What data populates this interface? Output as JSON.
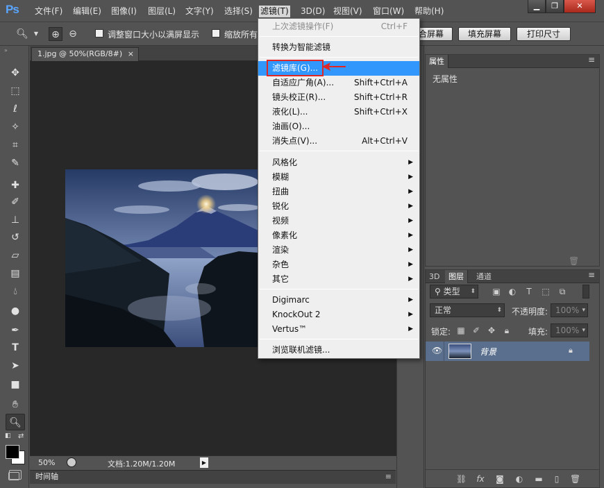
{
  "app": {
    "logo": "Ps"
  },
  "menubar": {
    "items": [
      "文件(F)",
      "编辑(E)",
      "图像(I)",
      "图层(L)",
      "文字(Y)",
      "选择(S)",
      "滤镜(T)",
      "3D(D)",
      "视图(V)",
      "窗口(W)",
      "帮助(H)"
    ],
    "active_index": 6,
    "window_buttons": [
      "minimize",
      "restore",
      "close"
    ]
  },
  "options_bar": {
    "resize_windows_label": "调整窗口大小以满屏显示",
    "zoom_all_label": "缩放所有",
    "fit_screen_label": "合屏幕",
    "fill_screen_label": "填充屏幕",
    "print_size_label": "打印尺寸"
  },
  "toolbox": {
    "tools": [
      "move-icon",
      "marquee-icon",
      "lasso-icon",
      "magic-wand-icon",
      "crop-icon",
      "eyedropper-icon",
      "healing-brush-icon",
      "brush-icon",
      "stamp-icon",
      "history-brush-icon",
      "eraser-icon",
      "gradient-icon",
      "blur-icon",
      "dodge-icon",
      "pen-icon",
      "type-icon",
      "path-select-icon",
      "rectangle-icon",
      "hand-icon",
      "zoom-icon"
    ],
    "selected": "zoom-icon"
  },
  "document": {
    "tab_label": "1.jpg @ 50%(RGB/8#)",
    "zoom": "50%",
    "doc_info": "文档:1.20M/1.20M"
  },
  "timeline": {
    "label": "时间轴"
  },
  "filter_menu": {
    "items": [
      {
        "label": "上次滤镜操作(F)",
        "shortcut": "Ctrl+F",
        "disabled": true
      },
      {
        "label": "转换为智能滤镜"
      },
      {
        "label": "滤镜库(G)...",
        "highlighted": true
      },
      {
        "label": "自适应广角(A)...",
        "shortcut": "Shift+Ctrl+A"
      },
      {
        "label": "镜头校正(R)...",
        "shortcut": "Shift+Ctrl+R"
      },
      {
        "label": "液化(L)...",
        "shortcut": "Shift+Ctrl+X"
      },
      {
        "label": "油画(O)..."
      },
      {
        "label": "消失点(V)...",
        "shortcut": "Alt+Ctrl+V"
      },
      {
        "label": "风格化",
        "submenu": true
      },
      {
        "label": "模糊",
        "submenu": true
      },
      {
        "label": "扭曲",
        "submenu": true
      },
      {
        "label": "锐化",
        "submenu": true
      },
      {
        "label": "视频",
        "submenu": true
      },
      {
        "label": "像素化",
        "submenu": true
      },
      {
        "label": "渲染",
        "submenu": true
      },
      {
        "label": "杂色",
        "submenu": true
      },
      {
        "label": "其它",
        "submenu": true
      },
      {
        "label": "Digimarc",
        "submenu": true
      },
      {
        "label": "KnockOut 2",
        "submenu": true
      },
      {
        "label": "Vertus™",
        "submenu": true
      },
      {
        "label": "浏览联机滤镜..."
      }
    ]
  },
  "properties_panel": {
    "tab": "属性",
    "content": "无属性"
  },
  "layers_panel": {
    "tabs": [
      "3D",
      "图层",
      "通道"
    ],
    "active_tab": "图层",
    "filter_kind": "类型",
    "blend_mode": "正常",
    "opacity_label": "不透明度:",
    "opacity_value": "100%",
    "lock_label": "锁定:",
    "fill_label": "填充:",
    "fill_value": "100%",
    "layers": [
      {
        "name": "背景",
        "visible": true,
        "locked": true
      }
    ]
  },
  "colors": {
    "ui_bg": "#535353",
    "canvas_bg": "#282828",
    "menu_highlight": "#3297fd",
    "annotation_red": "#e12626",
    "layer_selected": "#5a6f8d"
  }
}
